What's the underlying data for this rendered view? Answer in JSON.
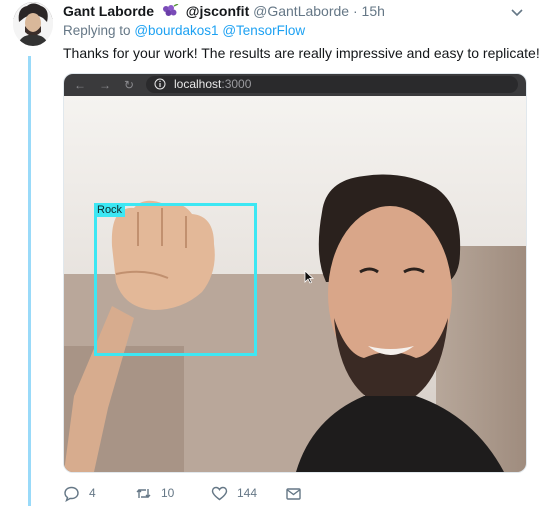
{
  "tweet": {
    "display_name": "Gant Laborde",
    "screen_name": "@jsconfit",
    "handle": "@GantLaborde",
    "separator": "·",
    "time": "15h",
    "replying_prefix": "Replying to",
    "mentions": [
      "@bourdakos1",
      "@TensorFlow"
    ],
    "text": "Thanks for your work!  The results are really impressive and easy to replicate!"
  },
  "browser": {
    "url_host": "localhost",
    "url_port": ":3000"
  },
  "detection": {
    "label": "Rock"
  },
  "actions": {
    "replies": "4",
    "retweets": "10",
    "likes": "144"
  },
  "colors": {
    "link": "#1da1f2",
    "muted": "#657786",
    "thread_line": "#99daf9",
    "detect_box": "#3de7f3"
  },
  "icons": [
    "avatar",
    "grapes-emoji",
    "chevron-down-icon",
    "back-arrow-icon",
    "forward-arrow-icon",
    "reload-icon",
    "info-icon",
    "mouse-cursor",
    "reply-icon",
    "retweet-icon",
    "like-icon",
    "share-icon"
  ]
}
